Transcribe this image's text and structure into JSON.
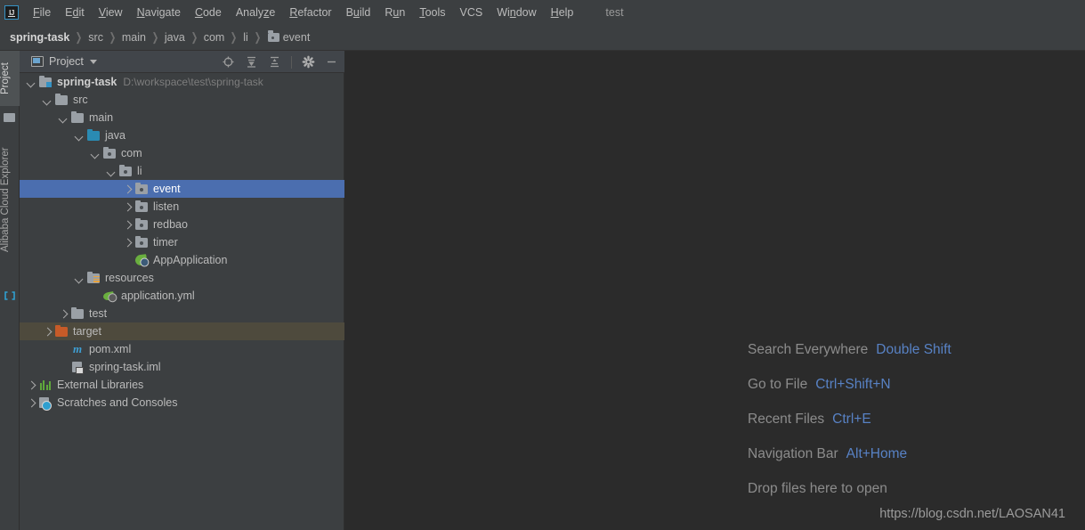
{
  "window": {
    "logo_text": "IJ",
    "project_label": "test"
  },
  "menubar": {
    "items": [
      {
        "label": "File",
        "mnemonic": "F"
      },
      {
        "label": "Edit",
        "mnemonic": "d"
      },
      {
        "label": "View",
        "mnemonic": "V"
      },
      {
        "label": "Navigate",
        "mnemonic": "N"
      },
      {
        "label": "Code",
        "mnemonic": "C"
      },
      {
        "label": "Analyze",
        "mnemonic": "z"
      },
      {
        "label": "Refactor",
        "mnemonic": "R"
      },
      {
        "label": "Build",
        "mnemonic": "u"
      },
      {
        "label": "Run",
        "mnemonic": "u"
      },
      {
        "label": "Tools",
        "mnemonic": "T"
      },
      {
        "label": "VCS",
        "mnemonic": ""
      },
      {
        "label": "Window",
        "mnemonic": "n"
      },
      {
        "label": "Help",
        "mnemonic": "H"
      }
    ]
  },
  "breadcrumb": {
    "items": [
      "spring-task",
      "src",
      "main",
      "java",
      "com",
      "li",
      "event"
    ]
  },
  "toolstrip": {
    "tabs": [
      {
        "label": "Project",
        "icon": "project-icon",
        "active": true
      },
      {
        "label": "Alibaba Cloud Explorer",
        "icon": "cloud-icon",
        "active": false
      }
    ]
  },
  "panel": {
    "title": "Project",
    "tools": [
      {
        "name": "locate-icon",
        "tooltip": "Select Opened File"
      },
      {
        "name": "expand-all-icon",
        "tooltip": "Expand All"
      },
      {
        "name": "collapse-all-icon",
        "tooltip": "Collapse All"
      },
      {
        "name": "gear-icon",
        "tooltip": "Settings"
      },
      {
        "name": "minimize-icon",
        "tooltip": "Hide"
      }
    ]
  },
  "tree": {
    "rows": [
      {
        "label": "spring-task",
        "path": "D:\\workspace\\test\\spring-task",
        "indent": 0,
        "arrow": "down",
        "icon": "module-folder",
        "bold": true,
        "state": "none"
      },
      {
        "label": "src",
        "path": "",
        "indent": 1,
        "arrow": "down",
        "icon": "folder-gray",
        "bold": false,
        "state": "none"
      },
      {
        "label": "main",
        "path": "",
        "indent": 2,
        "arrow": "down",
        "icon": "folder-gray",
        "bold": false,
        "state": "none"
      },
      {
        "label": "java",
        "path": "",
        "indent": 3,
        "arrow": "down",
        "icon": "folder-source",
        "bold": false,
        "state": "none"
      },
      {
        "label": "com",
        "path": "",
        "indent": 4,
        "arrow": "down",
        "icon": "folder-package",
        "bold": false,
        "state": "none"
      },
      {
        "label": "li",
        "path": "",
        "indent": 5,
        "arrow": "down",
        "icon": "folder-package",
        "bold": false,
        "state": "none"
      },
      {
        "label": "event",
        "path": "",
        "indent": 6,
        "arrow": "right",
        "icon": "folder-package",
        "bold": false,
        "state": "selected"
      },
      {
        "label": "listen",
        "path": "",
        "indent": 6,
        "arrow": "right",
        "icon": "folder-package",
        "bold": false,
        "state": "none"
      },
      {
        "label": "redbao",
        "path": "",
        "indent": 6,
        "arrow": "right",
        "icon": "folder-package",
        "bold": false,
        "state": "none"
      },
      {
        "label": "timer",
        "path": "",
        "indent": 6,
        "arrow": "right",
        "icon": "folder-package",
        "bold": false,
        "state": "none"
      },
      {
        "label": "AppApplication",
        "path": "",
        "indent": 6,
        "arrow": "none",
        "icon": "spring-boot-class",
        "bold": false,
        "state": "none"
      },
      {
        "label": "resources",
        "path": "",
        "indent": 3,
        "arrow": "down",
        "icon": "folder-resources",
        "bold": false,
        "state": "none"
      },
      {
        "label": "application.yml",
        "path": "",
        "indent": 4,
        "arrow": "none",
        "icon": "yaml-file",
        "bold": false,
        "state": "none"
      },
      {
        "label": "test",
        "path": "",
        "indent": 2,
        "arrow": "right",
        "icon": "folder-gray",
        "bold": false,
        "state": "none"
      },
      {
        "label": "target",
        "path": "",
        "indent": 1,
        "arrow": "right",
        "icon": "folder-excluded",
        "bold": false,
        "state": "highlight"
      },
      {
        "label": "pom.xml",
        "path": "",
        "indent": 2,
        "arrow": "none",
        "icon": "maven-file",
        "bold": false,
        "state": "none"
      },
      {
        "label": "spring-task.iml",
        "path": "",
        "indent": 2,
        "arrow": "none",
        "icon": "module-file",
        "bold": false,
        "state": "none"
      },
      {
        "label": "External Libraries",
        "path": "",
        "indent": 0,
        "arrow": "right",
        "icon": "libraries",
        "bold": false,
        "state": "none"
      },
      {
        "label": "Scratches and Consoles",
        "path": "",
        "indent": 0,
        "arrow": "right",
        "icon": "scratches",
        "bold": false,
        "state": "none"
      }
    ]
  },
  "editor": {
    "hints": [
      {
        "label": "Search Everywhere",
        "key": "Double Shift"
      },
      {
        "label": "Go to File",
        "key": "Ctrl+Shift+N"
      },
      {
        "label": "Recent Files",
        "key": "Ctrl+E"
      },
      {
        "label": "Navigation Bar",
        "key": "Alt+Home"
      },
      {
        "label": "Drop files here to open",
        "key": ""
      }
    ],
    "watermark": "https://blog.csdn.net/LAOSAN41"
  },
  "colors": {
    "panel_bg": "#3c3f41",
    "editor_bg": "#2b2b2b",
    "selection": "#4b6eaf",
    "highlight": "#4e4a3d",
    "accent_blue": "#5882c5",
    "text": "#bbbbbb"
  }
}
